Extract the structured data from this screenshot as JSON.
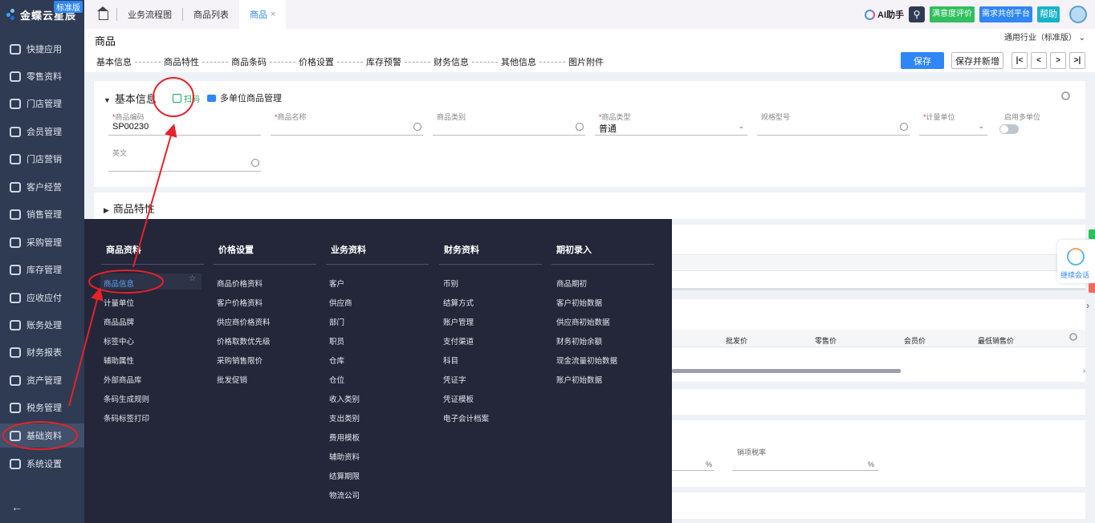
{
  "app": {
    "logo_text": "金蝶云星辰",
    "edition_badge": "标准版"
  },
  "sidebar": {
    "items": [
      {
        "label": "快捷应用",
        "icon": "grid-apps-icon"
      },
      {
        "label": "零售资料",
        "icon": "basket-icon"
      },
      {
        "label": "门店管理",
        "icon": "store-icon"
      },
      {
        "label": "会员管理",
        "icon": "heart-icon"
      },
      {
        "label": "门店营销",
        "icon": "bag-icon"
      },
      {
        "label": "客户经营",
        "icon": "user-icon"
      },
      {
        "label": "销售管理",
        "icon": "chart-icon"
      },
      {
        "label": "采购管理",
        "icon": "cart-icon"
      },
      {
        "label": "库存管理",
        "icon": "box-icon"
      },
      {
        "label": "应收应付",
        "icon": "coin-icon"
      },
      {
        "label": "账务处理",
        "icon": "ledger-icon"
      },
      {
        "label": "财务报表",
        "icon": "report-icon"
      },
      {
        "label": "资产管理",
        "icon": "asset-icon"
      },
      {
        "label": "税务管理",
        "icon": "tax-icon"
      },
      {
        "label": "基础资料",
        "icon": "layers-icon"
      },
      {
        "label": "系统设置",
        "icon": "settings-icon"
      }
    ],
    "collapse": "←"
  },
  "tabs": [
    {
      "label": "业务流程图"
    },
    {
      "label": "商品列表"
    },
    {
      "label": "商品",
      "close": "×"
    }
  ],
  "topbar": {
    "ai": "AI助手",
    "satisfaction": "满意度评价",
    "demand": "需求共创平台",
    "help": "帮助"
  },
  "header": {
    "title": "商品",
    "industry": "通用行业（标准版）",
    "steps": [
      "基本信息",
      "商品特性",
      "商品条码",
      "价格设置",
      "库存预警",
      "财务信息",
      "其他信息",
      "图片附件"
    ],
    "save": "保存",
    "save_new": "保存并新增",
    "pager": [
      "|<",
      "<",
      ">",
      ">|"
    ]
  },
  "basic": {
    "title": "基本信息",
    "scan": "扫码",
    "multi_unit": "多单位商品管理",
    "fields": [
      {
        "label": "商品编码",
        "required": true,
        "value": "SP00230"
      },
      {
        "label": "商品名称",
        "required": true,
        "value": ""
      },
      {
        "label": "商品类别",
        "required": false,
        "value": ""
      },
      {
        "label": "商品类型",
        "required": true,
        "value": "普通"
      },
      {
        "label": "规格型号",
        "required": false,
        "value": ""
      },
      {
        "label": "计量单位",
        "required": true,
        "value": ""
      },
      {
        "label": "英文",
        "required": false,
        "value": ""
      }
    ],
    "multi_unit_toggle_label": "启用多单位",
    "multi_unit_enabled": false
  },
  "features": {
    "title": "商品特性"
  },
  "price_table": {
    "headers": [
      "批发价",
      "零售价",
      "会员价",
      "最低销售价"
    ]
  },
  "finance": {
    "tax_label": "销项税率",
    "percent": "%"
  },
  "chat": {
    "label": "继续会话"
  },
  "mega_menu": {
    "columns": [
      {
        "title": "商品资料",
        "items": [
          "商品信息",
          "计量单位",
          "商品品牌",
          "标签中心",
          "辅助属性",
          "外部商品库",
          "条码生成规则",
          "条码标签打印"
        ]
      },
      {
        "title": "价格设置",
        "items": [
          "商品价格资料",
          "客户价格资料",
          "供应商价格资料",
          "价格取数优先级",
          "采购销售限价",
          "批发促销"
        ]
      },
      {
        "title": "业务资料",
        "items": [
          "客户",
          "供应商",
          "部门",
          "职员",
          "仓库",
          "仓位",
          "收入类别",
          "支出类别",
          "费用模板",
          "辅助资料",
          "结算期限",
          "物流公司"
        ]
      },
      {
        "title": "财务资料",
        "items": [
          "币别",
          "结算方式",
          "账户管理",
          "支付渠道",
          "科目",
          "凭证字",
          "凭证模板",
          "电子会计档案"
        ]
      },
      {
        "title": "期初录入",
        "items": [
          "商品期初",
          "客户初始数据",
          "供应商初始数据",
          "财务初始余额",
          "现金流量初始数据",
          "账户初始数据"
        ]
      }
    ],
    "highlighted": "商品信息"
  },
  "colors": {
    "sidebar_bg": "#2f3b52",
    "menu_bg": "#232739",
    "accent": "#2f86f6",
    "annotation_red": "#e5222a",
    "scan_green": "#17a55e"
  }
}
